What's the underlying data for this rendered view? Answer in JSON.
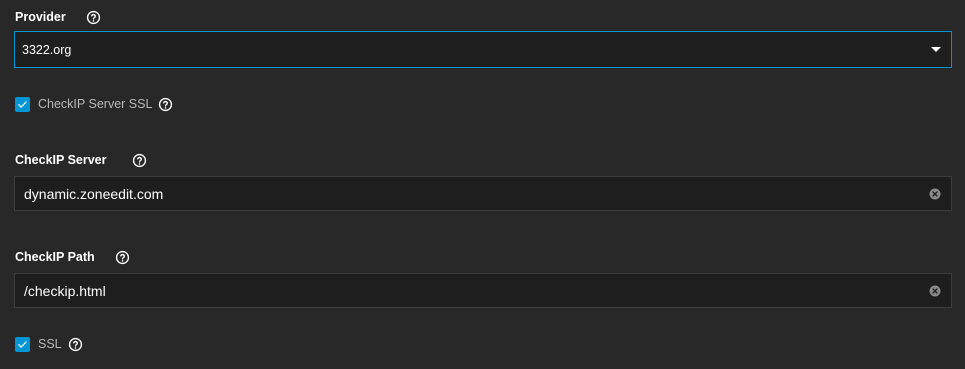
{
  "provider": {
    "label": "Provider",
    "value": "3322.org",
    "help_icon": "help-circle-icon",
    "dropdown_icon": "caret-down-icon"
  },
  "checkip_server_ssl": {
    "label": "CheckIP Server SSL",
    "checked": true,
    "help_icon": "help-circle-icon"
  },
  "checkip_server": {
    "label": "CheckIP Server",
    "value": "dynamic.zoneedit.com",
    "help_icon": "help-circle-icon",
    "clear_icon": "clear-circle-icon"
  },
  "checkip_path": {
    "label": "CheckIP Path",
    "value": "/checkip.html",
    "help_icon": "help-circle-icon",
    "clear_icon": "clear-circle-icon"
  },
  "ssl": {
    "label": "SSL",
    "checked": true,
    "help_icon": "help-circle-icon"
  },
  "colors": {
    "background": "#282828",
    "field_background": "#1e1e1e",
    "accent": "#0095d5",
    "field_border": "#3d3d3d"
  }
}
